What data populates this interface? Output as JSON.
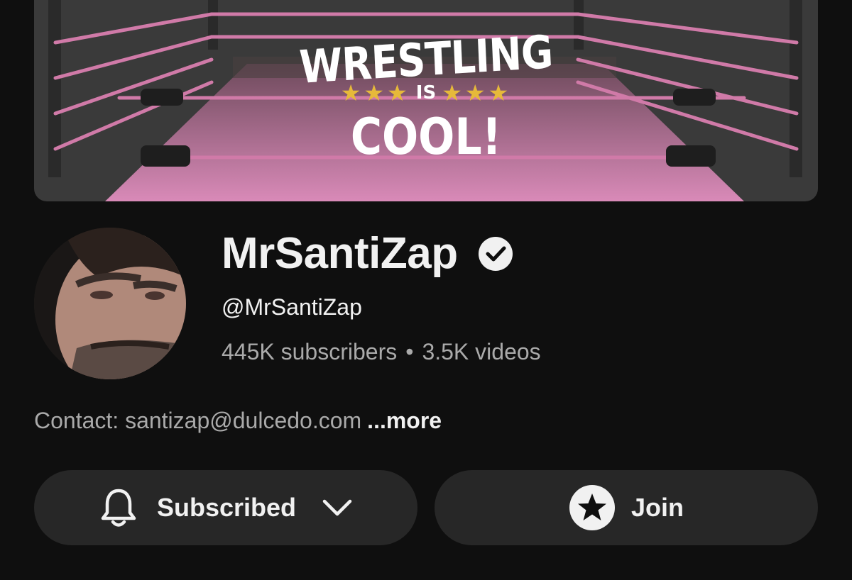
{
  "banner": {
    "line1": "WRESTLING",
    "stars_left": "★★★",
    "line2": "IS",
    "stars_right": "★★★",
    "line3": "COOL!"
  },
  "channel": {
    "name": "MrSantiZap",
    "handle": "@MrSantiZap",
    "subscribers": "445K subscribers",
    "separator": "•",
    "videos": "3.5K videos",
    "verified_icon": "verified-check-icon"
  },
  "description": {
    "text": "Contact: santizap@dulcedo.com",
    "more_label": "...more"
  },
  "actions": {
    "subscribed_label": "Subscribed",
    "subscribed_icon": "bell-icon",
    "dropdown_icon": "chevron-down-icon",
    "join_label": "Join",
    "join_icon": "star-circle-icon"
  },
  "colors": {
    "background": "#0f0f0f",
    "button_bg": "#272727",
    "ring_pink": "#d07aa8",
    "star_gold": "#e6b93a",
    "secondary_text": "#aaaaaa"
  }
}
